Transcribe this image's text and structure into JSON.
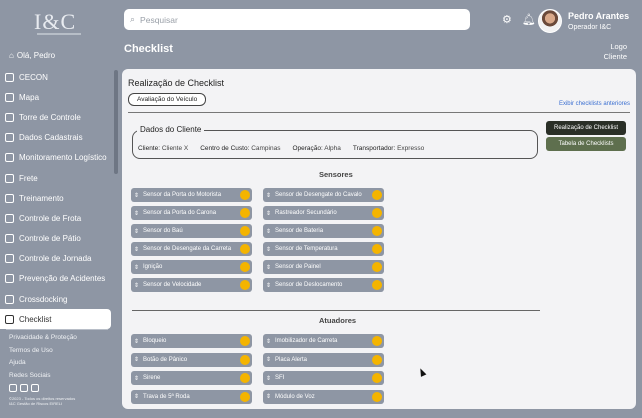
{
  "brand": {
    "logo": "I&C"
  },
  "sidebar": {
    "greeting": "Olá, Pedro",
    "items": [
      {
        "label": "CECON",
        "icon": "table-icon"
      },
      {
        "label": "Mapa",
        "icon": "map-icon"
      },
      {
        "label": "Torre de Controle",
        "icon": "control-tower-icon"
      },
      {
        "label": "Dados Cadastrais",
        "icon": "registration-icon"
      },
      {
        "label": "Monitoramento Logístico",
        "icon": "monitor-icon"
      },
      {
        "label": "Frete",
        "icon": "truck-icon"
      },
      {
        "label": "Treinamento",
        "icon": "training-icon"
      },
      {
        "label": "Controle de Frota",
        "icon": "fleet-icon"
      },
      {
        "label": "Controle de Pátio",
        "icon": "yard-icon"
      },
      {
        "label": "Controle de Jornada",
        "icon": "clock-icon"
      },
      {
        "label": "Prevenção de Acidentes",
        "icon": "accident-icon"
      },
      {
        "label": "Crossdocking",
        "icon": "crossdocking-icon"
      },
      {
        "label": "Checklist",
        "icon": "checklist-icon",
        "active": true
      }
    ],
    "footer_links": [
      "Privacidade & Proteção",
      "Termos de Uso",
      "Ajuda",
      "Redes Sociais"
    ],
    "copyright": [
      "©2023 - Todos os direitos reservados",
      "I&C Gestão de Riscos EIRELI"
    ]
  },
  "search": {
    "placeholder": "Pesquisar"
  },
  "user": {
    "name": "Pedro Arantes",
    "role": "Operador I&C"
  },
  "page": {
    "title": "Checklist",
    "top_right_logo_line1": "Logo",
    "top_right_logo_line2": "Cliente"
  },
  "checklist": {
    "heading": "Realização de Checklist",
    "tab": "Avaliação do Veículo",
    "previous_link": "Exibir checklists anteriores",
    "client_legend": "Dados do Cliente",
    "client_fields": [
      {
        "label": "Cliente:",
        "value": "Cliente X"
      },
      {
        "label": "Centro de Custo:",
        "value": "Campinas"
      },
      {
        "label": "Operação:",
        "value": "Alpha"
      },
      {
        "label": "Transportador:",
        "value": "Expresso"
      }
    ],
    "btn_realizacao": "Realização de Checklist",
    "btn_tabela": "Tabela de Checklists",
    "sensors_title": "Sensores",
    "sensors_left": [
      "Sensor da Porta do Motorista",
      "Sensor da Porta do Carona",
      "Sensor do Baú",
      "Sensor de Desengate da Carreta",
      "Ignição",
      "Sensor de Velocidade"
    ],
    "sensors_right": [
      "Sensor de Desengate do Cavalo",
      "Rastreador Secundário",
      "Sensor de Bateria",
      "Sensor de Temperatura",
      "Sensor de Painel",
      "Sensor de Deslocamento"
    ],
    "actuators_title": "Atuadores",
    "actuators_left": [
      "Bloqueio",
      "Botão de Pânico",
      "Sirene",
      "Trava de 5ª Roda"
    ],
    "actuators_right": [
      "Imobilizador de Carreta",
      "Placa Alerta",
      "SFI",
      "Módulo de Voz"
    ],
    "status_color": "#f4b400"
  }
}
